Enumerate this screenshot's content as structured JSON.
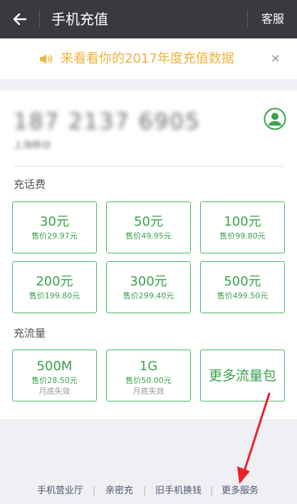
{
  "header": {
    "title": "手机充值",
    "service_label": "客服"
  },
  "banner": {
    "text": "来看看你的2017年度充值数据",
    "close_label": "×"
  },
  "account": {
    "phone_number": "187 2137 6905",
    "operator": "上海移动"
  },
  "recharge": {
    "heading": "充话费",
    "options": [
      {
        "amount": "30元",
        "price": "售价29.97元"
      },
      {
        "amount": "50元",
        "price": "售价49.95元"
      },
      {
        "amount": "100元",
        "price": "售价99.80元"
      },
      {
        "amount": "200元",
        "price": "售价199.80元"
      },
      {
        "amount": "300元",
        "price": "售价299.40元"
      },
      {
        "amount": "500元",
        "price": "售价499.50元"
      }
    ]
  },
  "data_plans": {
    "heading": "充流量",
    "options": [
      {
        "amount": "500M",
        "price": "售价28.50元",
        "note": "月底失效"
      },
      {
        "amount": "1G",
        "price": "售价50.00元",
        "note": "月底失效"
      }
    ],
    "more_label": "更多流量包"
  },
  "footer": {
    "links": [
      "手机营业厅",
      "亲密充",
      "旧手机换钱",
      "更多服务"
    ],
    "separator": "|"
  },
  "colors": {
    "header_bg": "#393a3f",
    "accent_green": "#3aa14c",
    "banner_text": "#f0b23c",
    "annotation_red": "#e8232b"
  }
}
